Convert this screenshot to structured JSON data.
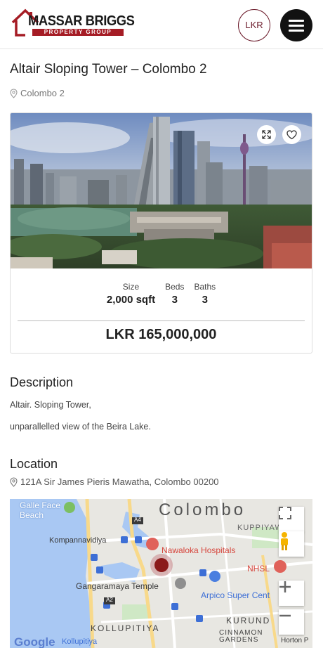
{
  "header": {
    "brand_name": "MASSAR BRIGGS",
    "brand_sub": "PROPERTY GROUP",
    "currency_button": "LKR",
    "menu_icon": "hamburger-menu-icon"
  },
  "property": {
    "title": "Altair Sloping Tower – Colombo 2",
    "location": "Colombo 2",
    "stats": [
      {
        "label": "Size",
        "value": "2,000 sqft"
      },
      {
        "label": "Beds",
        "value": "3"
      },
      {
        "label": "Baths",
        "value": "3"
      }
    ],
    "price": "LKR 165,000,000"
  },
  "description": {
    "heading": "Description",
    "lines": [
      "Altair. Sloping Tower,",
      "unparallelled view of the Beira Lake."
    ]
  },
  "location": {
    "heading": "Location",
    "address": "121A Sir James Pieris Mawatha, Colombo 00200"
  },
  "map": {
    "labels": {
      "galle_face": "Galle Face\nBeach",
      "colombo": "Colombo",
      "kuppiyawatta": "KUPPIYAWA",
      "kompannavidiya": "Kompannavidiya",
      "nawaloka": "Nawaloka Hospitals",
      "nhsl": "NHSL",
      "gangaramaya": "Gangaramaya Temple",
      "arpico": "Arpico Super Cent",
      "kollupitiya": "KOLLUPITIYA",
      "kurunduwatta": "KURUND",
      "cinnamon": "CINNAMON\nGARDENS",
      "kollupitiya_station": "Kollupitiya",
      "google": "Google",
      "horton": "Horton P",
      "a4": "A4",
      "a2": "A2"
    },
    "colors": {
      "water": "#a9c8f3",
      "hospital": "#e0625a",
      "transit": "#3d6fd6",
      "marker": "#8b1a1a"
    }
  }
}
